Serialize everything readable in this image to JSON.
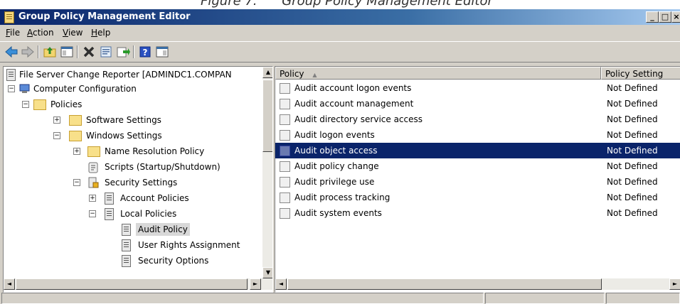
{
  "caption": {
    "text": "Figure 7:      Group Policy Management Editor"
  },
  "window": {
    "title": "Group Policy Management Editor",
    "minimize": "_",
    "maximize": "□",
    "close": "×"
  },
  "menu": [
    {
      "label": "File",
      "accel": "F",
      "rest": "ile"
    },
    {
      "label": "Action",
      "accel": "A",
      "rest": "ction"
    },
    {
      "label": "View",
      "accel": "V",
      "rest": "iew"
    },
    {
      "label": "Help",
      "accel": "H",
      "rest": "elp"
    }
  ],
  "toolbar": [
    "back-icon",
    "forward-icon",
    "up-folder-icon",
    "show-hide-tree-icon",
    "delete-icon",
    "properties-icon",
    "export-list-icon",
    "help-icon",
    "show-hide-action-pane-icon"
  ],
  "tree": {
    "root": "File Server Change Reporter [ADMINDC1.COMPAN",
    "computer_configuration": "Computer Configuration",
    "policies": "Policies",
    "software_settings": "Software Settings",
    "windows_settings": "Windows Settings",
    "name_resolution_policy": "Name Resolution Policy",
    "scripts": "Scripts (Startup/Shutdown)",
    "security_settings": "Security Settings",
    "account_policies": "Account Policies",
    "local_policies": "Local Policies",
    "audit_policy": "Audit Policy",
    "user_rights_assignment": "User Rights Assignment",
    "security_options": "Security Options",
    "expanders": {
      "plus": "+",
      "minus": "−"
    }
  },
  "list": {
    "columns": {
      "policy": "Policy",
      "sort_indicator": "▲",
      "setting": "Policy Setting"
    },
    "rows": [
      {
        "policy": "Audit account logon events",
        "setting": "Not Defined"
      },
      {
        "policy": "Audit account management",
        "setting": "Not Defined"
      },
      {
        "policy": "Audit directory service access",
        "setting": "Not Defined"
      },
      {
        "policy": "Audit logon events",
        "setting": "Not Defined"
      },
      {
        "policy": "Audit object access",
        "setting": "Not Defined",
        "selected": true
      },
      {
        "policy": "Audit policy change",
        "setting": "Not Defined"
      },
      {
        "policy": "Audit privilege use",
        "setting": "Not Defined"
      },
      {
        "policy": "Audit process tracking",
        "setting": "Not Defined"
      },
      {
        "policy": "Audit system events",
        "setting": "Not Defined"
      }
    ]
  },
  "scroll": {
    "up": "▲",
    "down": "▼",
    "left": "◄",
    "right": "►"
  },
  "colors": {
    "title_start": "#0a246a",
    "title_end": "#a6caf0",
    "chrome": "#d4d0c8",
    "selection": "#0a246a"
  }
}
